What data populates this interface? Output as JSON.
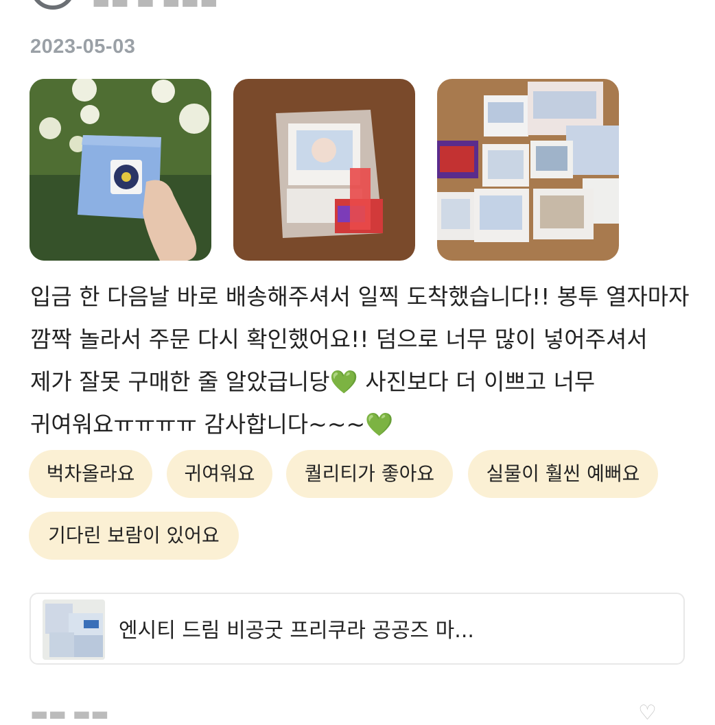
{
  "header": {
    "date": "2023-05-03"
  },
  "review": {
    "text": "입금 한 다음날 바로 배송해주셔서 일찍 도착했습니다!! 봉투 열자마자 깜짝 놀라서 주문 다시 확인했어요!! 덤으로 너무 많이 넣어주셔서 제가 잘못 구매한 줄 알았급니당💚 사진보다 더 이쁘고 너무 귀여워요ㅠㅠㅠㅠ 감사합니다~~~💚"
  },
  "tags": [
    "벅차올라요",
    "귀여워요",
    "퀄리티가 좋아요",
    "실물이 훨씬 예뻐요",
    "기다린 보람이 있어요"
  ],
  "product": {
    "title": "엔시티 드림 비공굿 프리쿠라 공공즈 마..."
  },
  "icons": {
    "photo1": "hydrangea-envelope-photo",
    "photo2": "wrapped-package-photo",
    "photo3": "photocards-photo"
  }
}
